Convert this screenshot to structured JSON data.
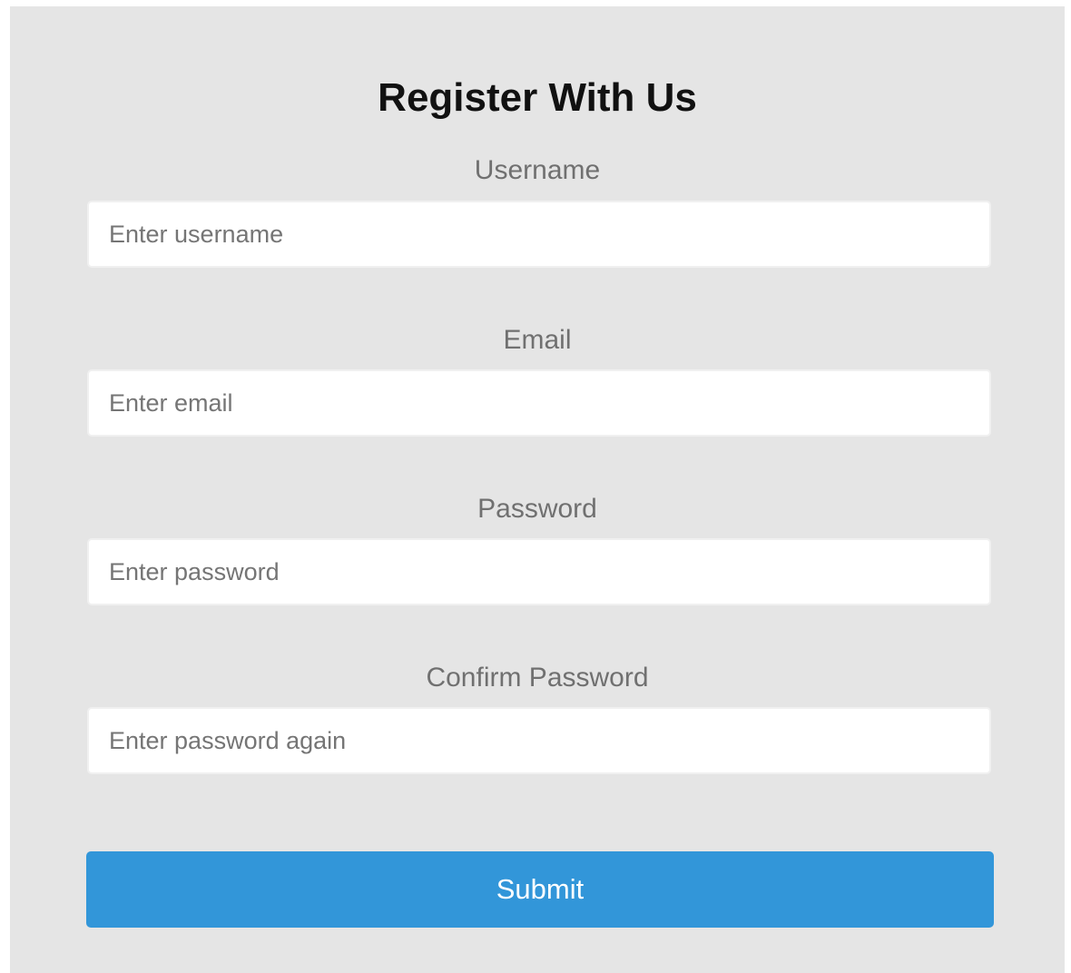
{
  "form": {
    "title": "Register With Us",
    "fields": [
      {
        "label": "Username",
        "placeholder": "Enter username",
        "value": ""
      },
      {
        "label": "Email",
        "placeholder": "Enter email",
        "value": ""
      },
      {
        "label": "Password",
        "placeholder": "Enter password",
        "value": ""
      },
      {
        "label": "Confirm Password",
        "placeholder": "Enter password again",
        "value": ""
      }
    ],
    "submit_label": "Submit"
  },
  "colors": {
    "card_background": "#e5e5e5",
    "button_background": "#3296d9",
    "label_text": "#707070"
  }
}
